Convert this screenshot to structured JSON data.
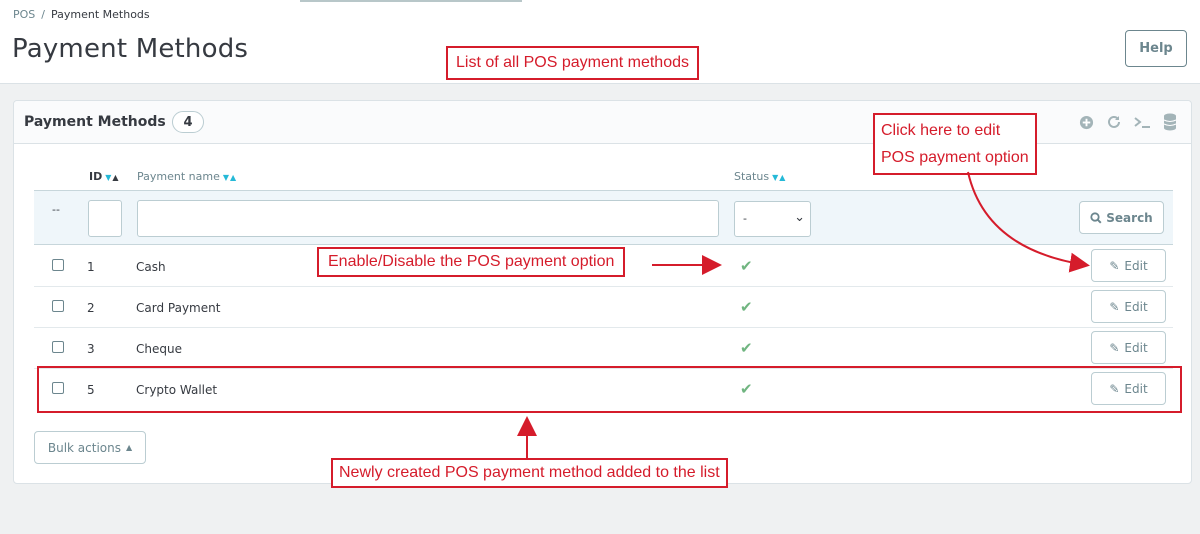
{
  "breadcrumb": {
    "parent": "POS",
    "separator": "/",
    "current": "Payment Methods"
  },
  "page_title": "Payment Methods",
  "help_label": "Help",
  "panel": {
    "title": "Payment Methods",
    "count": "4",
    "tools": [
      "plus-circle-icon",
      "refresh-icon",
      "terminal-icon",
      "database-icon"
    ]
  },
  "columns": {
    "id": "ID",
    "name": "Payment name",
    "status": "Status"
  },
  "filters": {
    "dash": "--",
    "status_selected": "-",
    "search_label": "Search"
  },
  "rows": [
    {
      "id": "1",
      "name": "Cash",
      "status": "enabled"
    },
    {
      "id": "2",
      "name": "Card Payment",
      "status": "enabled"
    },
    {
      "id": "3",
      "name": "Cheque",
      "status": "enabled"
    },
    {
      "id": "5",
      "name": "Crypto Wallet",
      "status": "enabled"
    }
  ],
  "edit_label": "Edit",
  "bulk_label": "Bulk actions",
  "annotations": {
    "list_note": "List of all POS payment methods",
    "edit_note_line1": "Click here to edit",
    "edit_note_line2": "POS payment option",
    "status_note": "Enable/Disable the POS payment option",
    "new_note": "Newly created POS payment method added to the list"
  },
  "colors": {
    "annotation": "#d51c2b",
    "accent": "#25b9d7",
    "status_ok": "#70b580"
  }
}
